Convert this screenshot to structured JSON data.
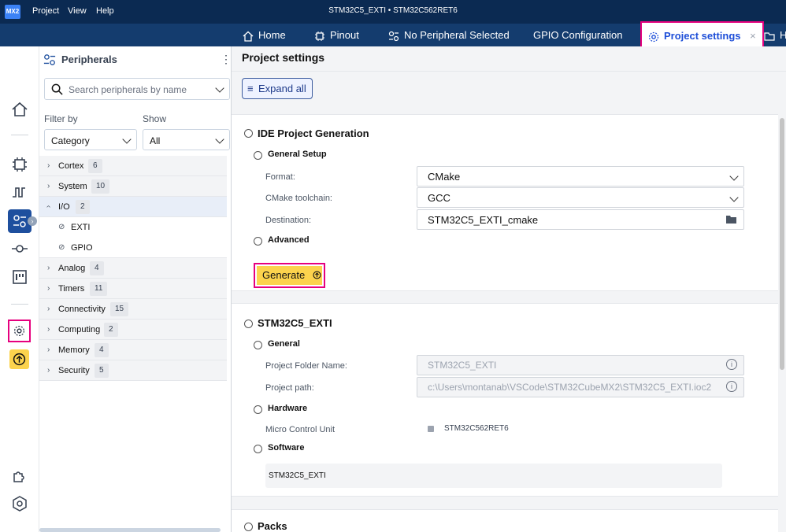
{
  "topbar": {
    "logo": "MX2",
    "menus": [
      "Project",
      "View",
      "Help"
    ],
    "window_title": "STM32C5_EXTI  •  STM32C562RET6"
  },
  "tabs": [
    {
      "label": "Home",
      "icon": "home-icon"
    },
    {
      "label": "Pinout",
      "icon": "chip-icon"
    },
    {
      "label": "No Peripheral Selected",
      "icon": "peripheral-icon"
    },
    {
      "label": "GPIO Configuration",
      "icon": ""
    },
    {
      "label": "Project settings",
      "icon": "gear-icon",
      "active": true
    },
    {
      "label": "H",
      "icon": "folder-icon"
    }
  ],
  "sidebar": {
    "title": "Peripherals",
    "search_placeholder": "Search peripherals by name",
    "filter_label": "Filter by",
    "show_label": "Show",
    "filter_value": "Category",
    "show_value": "All",
    "categories": [
      {
        "name": "Cortex",
        "count": "6"
      },
      {
        "name": "System",
        "count": "10"
      },
      {
        "name": "I/O",
        "count": "2",
        "open": true,
        "children": [
          "EXTI",
          "GPIO"
        ]
      },
      {
        "name": "Analog",
        "count": "4"
      },
      {
        "name": "Timers",
        "count": "11"
      },
      {
        "name": "Connectivity",
        "count": "15"
      },
      {
        "name": "Computing",
        "count": "2"
      },
      {
        "name": "Memory",
        "count": "4"
      },
      {
        "name": "Security",
        "count": "5"
      }
    ]
  },
  "main": {
    "title": "Project settings",
    "expand_all": "Expand all",
    "ide": {
      "title": "IDE Project Generation",
      "general_setup": "General Setup",
      "format_label": "Format:",
      "format_value": "CMake",
      "toolchain_label": "CMake toolchain:",
      "toolchain_value": "GCC",
      "destination_label": "Destination:",
      "destination_value": "STM32C5_EXTI_cmake",
      "advanced": "Advanced",
      "generate": "Generate"
    },
    "project": {
      "title": "STM32C5_EXTI",
      "general": "General",
      "folder_label": "Project Folder Name:",
      "folder_value": "STM32C5_EXTI",
      "path_label": "Project path:",
      "path_value": "c:\\Users\\montanab\\VSCode\\STM32CubeMX2\\STM32C5_EXTI.ioc2",
      "hardware": "Hardware",
      "mcu_label": "Micro Control Unit",
      "mcu_value": "STM32C562RET6",
      "software": "Software",
      "software_value": "STM32C5_EXTI"
    },
    "packs": "Packs"
  },
  "colors": {
    "topbar": "#0b2a52",
    "tabbar": "#143c6e",
    "highlight": "#e6007e",
    "generate": "#fcd34d"
  }
}
